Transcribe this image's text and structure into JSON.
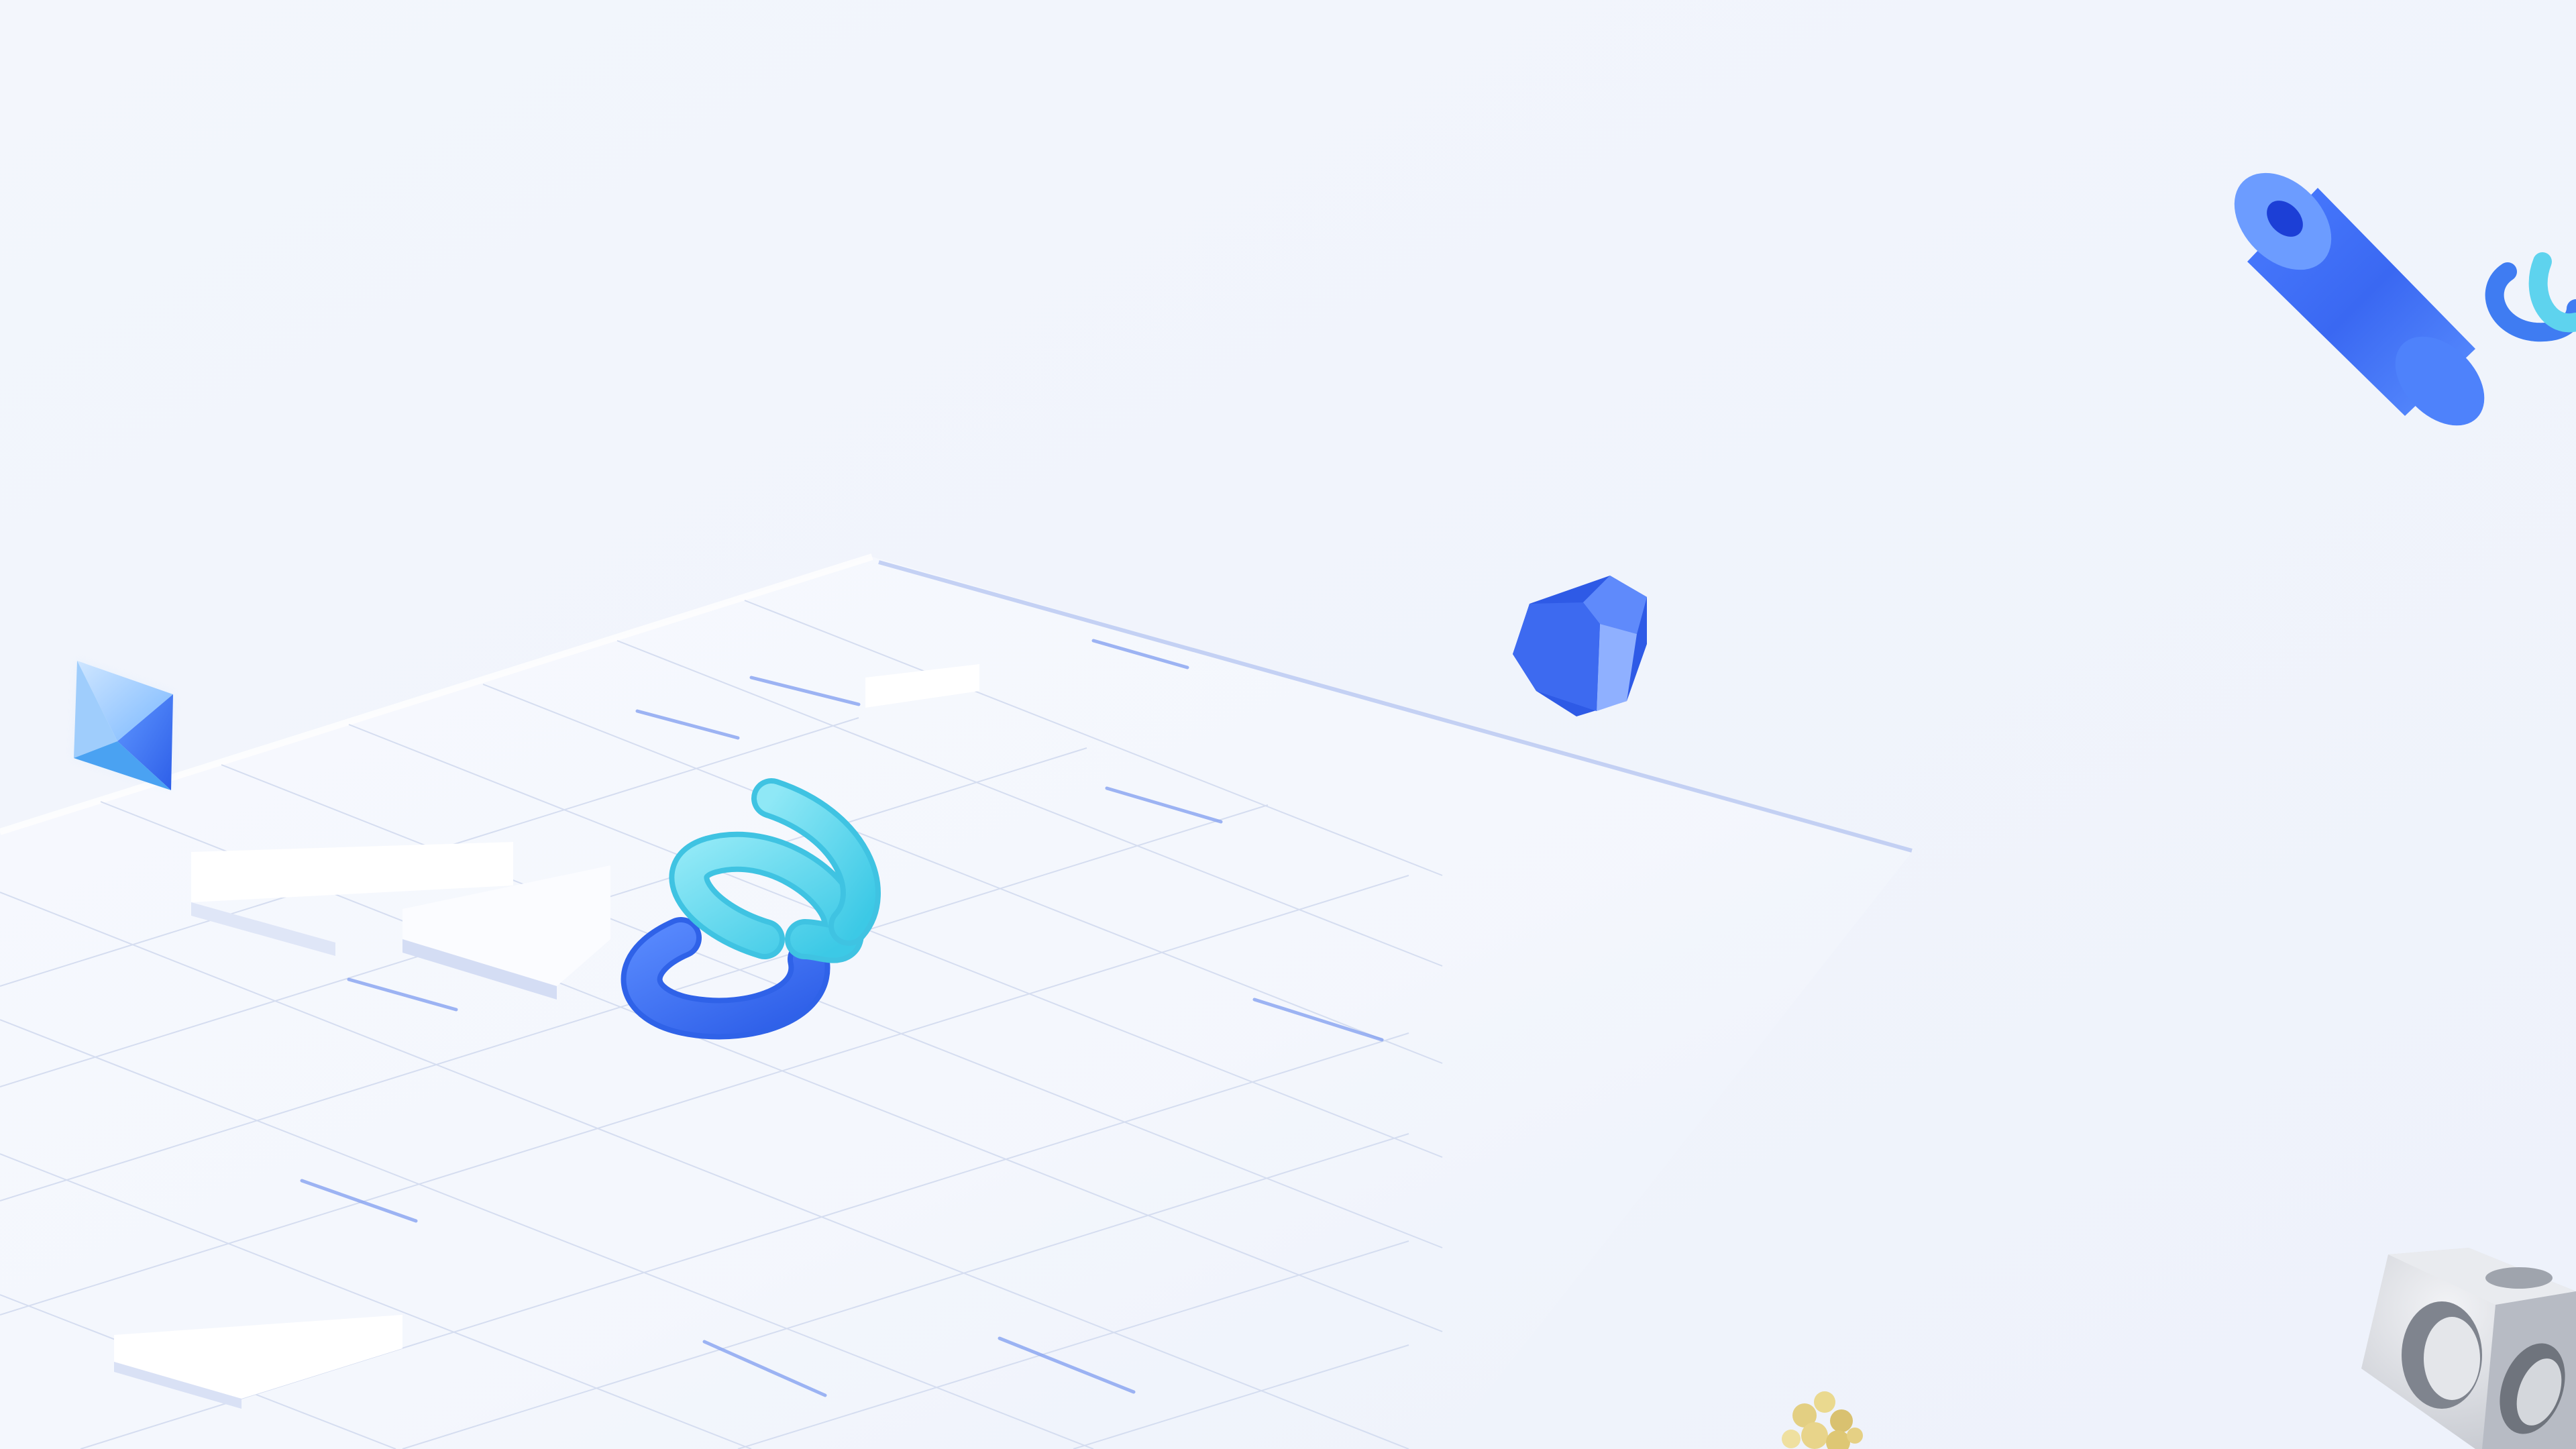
{
  "scene": {
    "kind": "decorative 3D wallpaper background",
    "colors": {
      "background": "#f0f4fc",
      "floor_tile": "#f6f8fd",
      "tile_line": "#c9d4ee",
      "accent_blue": "#3f6ff0",
      "accent_cyan": "#5fd8ee",
      "gold": "#e7d48a",
      "gray": "#cfd2d8"
    },
    "objects": [
      {
        "name": "isometric-grid-floor"
      },
      {
        "name": "pyramid-octahedron-shape"
      },
      {
        "name": "spiral-spring-shape"
      },
      {
        "name": "faceted-gem-shape"
      },
      {
        "name": "hollow-cylinder-tube"
      },
      {
        "name": "small-spring-shape"
      },
      {
        "name": "hollow-cube-frame"
      },
      {
        "name": "gold-cluster-shape"
      }
    ]
  }
}
